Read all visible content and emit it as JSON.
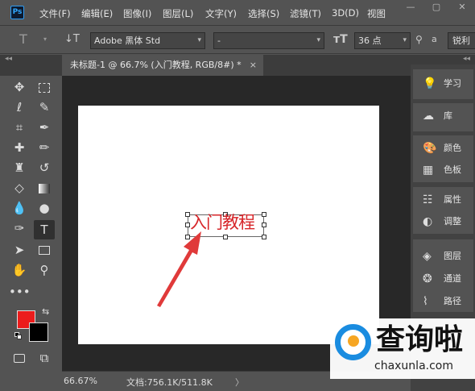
{
  "menubar": {
    "logo": "Ps",
    "items": [
      "文件(F)",
      "编辑(E)",
      "图像(I)",
      "图层(L)",
      "文字(Y)",
      "选择(S)",
      "滤镜(T)",
      "3D(D)",
      "视图"
    ],
    "window_buttons": [
      "—",
      "▢",
      "✕"
    ]
  },
  "options": {
    "tool_preset_icon": "text-tool-icon",
    "font_family": "Adobe 黑体 Std",
    "font_style": "-",
    "font_size": "36 点",
    "aa_label": "a",
    "aa_value": "锐利"
  },
  "document": {
    "tab_title": "未标题-1 @ 66.7% (入门教程, RGB/8#) *",
    "close": "×",
    "text_layer": "入门教程",
    "text_color": "#d7262a"
  },
  "colors": {
    "foreground": "#ec1c1c",
    "background": "#000000"
  },
  "status": {
    "zoom": "66.67%",
    "doc_info": "文档:756.1K/511.8K",
    "more": "〉"
  },
  "panels": {
    "items": [
      "学习",
      "库",
      "颜色",
      "色板",
      "属性",
      "调整",
      "图层",
      "通道",
      "路径"
    ]
  },
  "watermark": {
    "title": "查询啦",
    "url": "chaxunla.com"
  },
  "collapse": "◂◂"
}
